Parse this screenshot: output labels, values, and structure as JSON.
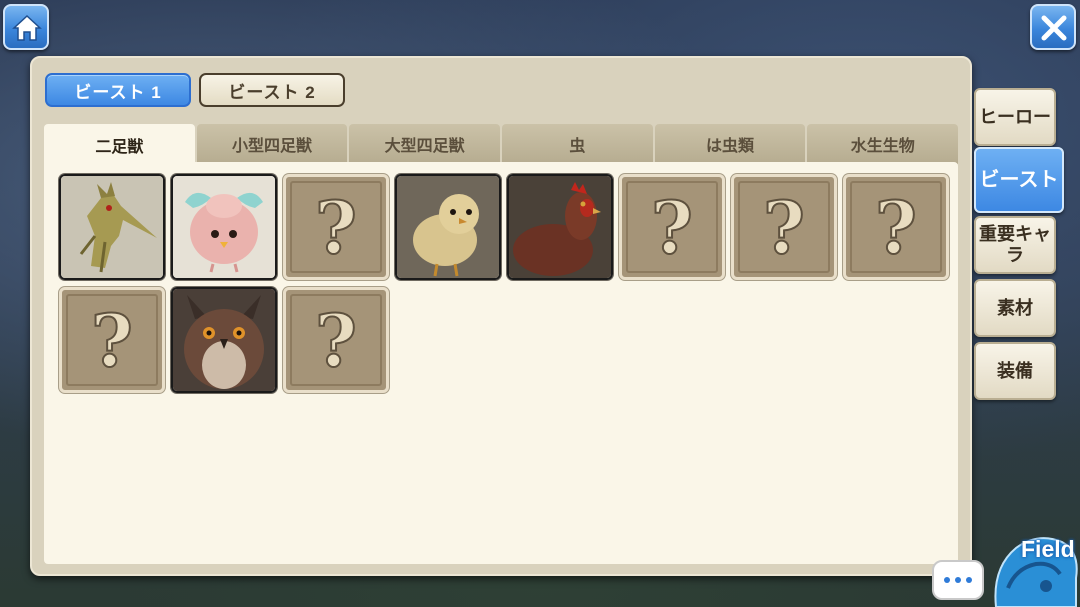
{
  "header": {
    "home_icon": "home-icon",
    "close_icon": "close-icon"
  },
  "pages": [
    {
      "label": "ビースト 1",
      "active": true
    },
    {
      "label": "ビースト 2",
      "active": false
    }
  ],
  "tabs": [
    {
      "label": "二足獣",
      "active": true
    },
    {
      "label": "小型四足獣",
      "active": false
    },
    {
      "label": "大型四足獣",
      "active": false
    },
    {
      "label": "虫",
      "active": false
    },
    {
      "label": "は虫類",
      "active": false
    },
    {
      "label": "水生生物",
      "active": false
    }
  ],
  "entries": [
    {
      "state": "known",
      "icon": "bird-creature-icon"
    },
    {
      "state": "known",
      "icon": "pink-puffball-icon"
    },
    {
      "state": "unknown",
      "symbol": "?"
    },
    {
      "state": "known",
      "icon": "chick-icon"
    },
    {
      "state": "known",
      "icon": "hen-icon"
    },
    {
      "state": "unknown",
      "symbol": "?"
    },
    {
      "state": "unknown",
      "symbol": "?"
    },
    {
      "state": "unknown",
      "symbol": "?"
    },
    {
      "state": "unknown",
      "symbol": "?"
    },
    {
      "state": "known",
      "icon": "owl-icon"
    },
    {
      "state": "unknown",
      "symbol": "?"
    }
  ],
  "side_menu": [
    {
      "label": "ヒーロー",
      "active": false
    },
    {
      "label": "ビースト",
      "active": true
    },
    {
      "label": "重要キャラ",
      "active": false
    },
    {
      "label": "素材",
      "active": false
    },
    {
      "label": "装備",
      "active": false
    }
  ],
  "footer": {
    "field_label": "Field",
    "chat_icon": "chat-bubble-icon"
  },
  "colors": {
    "accent_blue": "#3d88e3",
    "panel_bg": "#faf6e8",
    "tab_bg": "#b6ac90",
    "unknown_slot": "#a59478"
  }
}
